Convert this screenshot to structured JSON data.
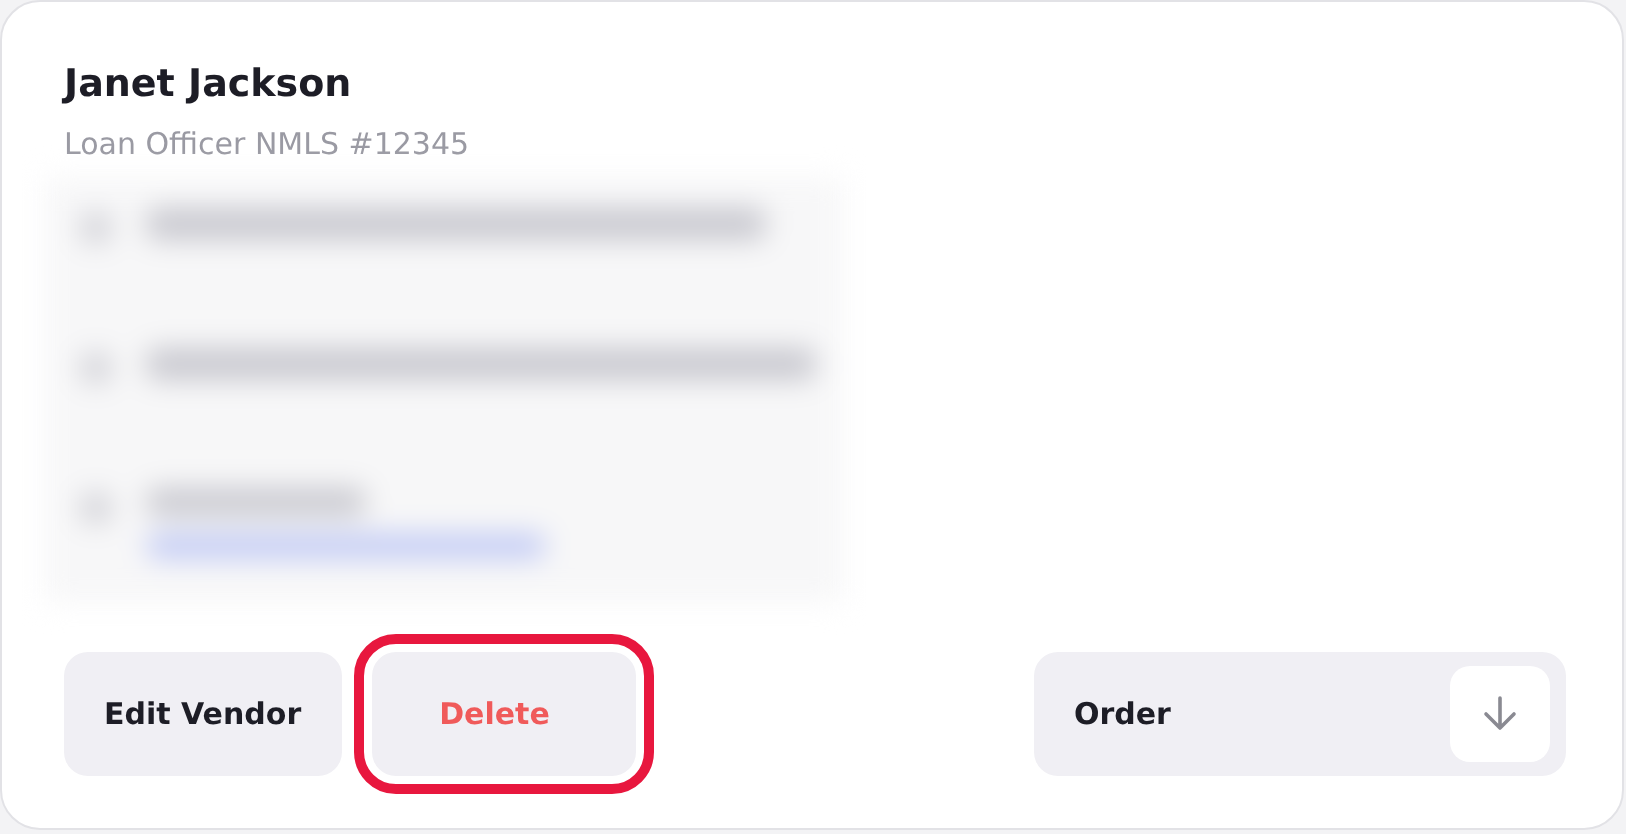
{
  "vendor": {
    "name": "Janet Jackson",
    "subtitle": "Loan Officer NMLS #12345"
  },
  "buttons": [
    {
      "label": "Edit Vendor",
      "kind": "plain",
      "highlighted": false
    },
    {
      "label": "Delete",
      "kind": "danger",
      "highlighted": true
    },
    {
      "label": "Order",
      "kind": "menu",
      "highlighted": false
    }
  ]
}
